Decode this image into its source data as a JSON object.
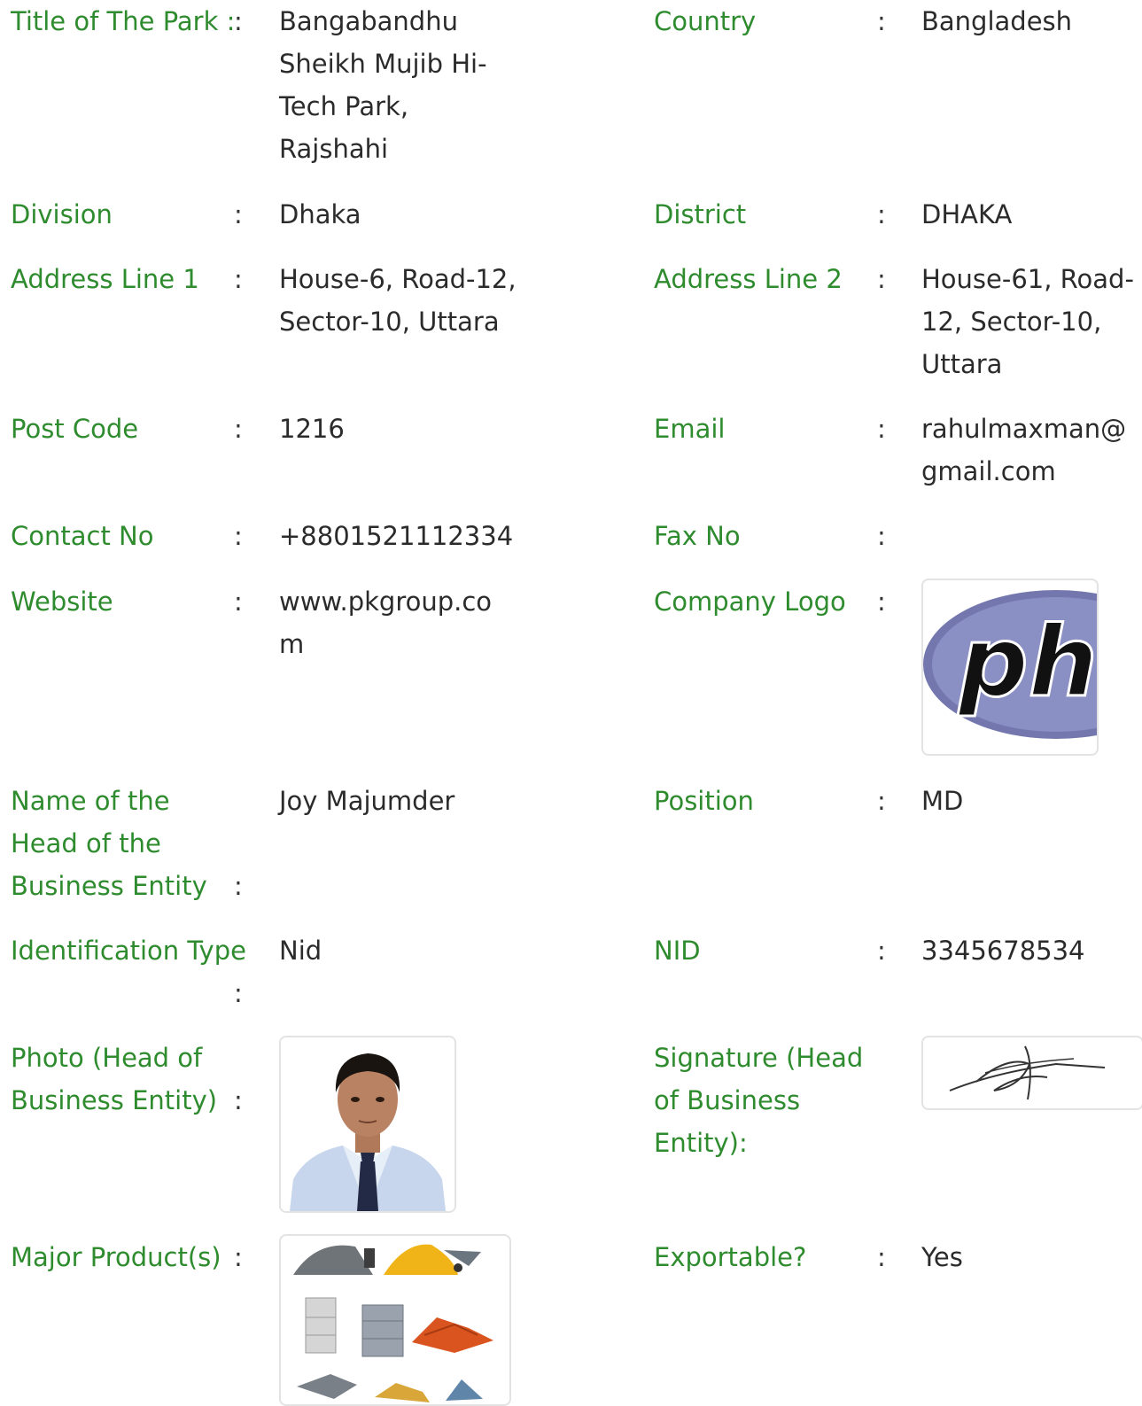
{
  "labels": {
    "title_of_park": "Title of The Park :",
    "country": "Country",
    "division": "Division",
    "district": "District",
    "address1": "Address Line 1",
    "address2": "Address Line 2",
    "post_code": "Post Code",
    "email": "Email",
    "contact_no": "Contact No",
    "fax_no": "Fax No",
    "website": "Website",
    "company_logo": "Company Logo",
    "head_name": "Name of the Head of the Business Entity",
    "position": "Position",
    "id_type": "Identification Type",
    "nid": "NID",
    "photo_head": "Photo (Head of Business Entity)",
    "signature_head": "Signature (Head of Business Entity):",
    "major_products": "Major Product(s)",
    "exportable": "Exportable?"
  },
  "colon": ":",
  "values": {
    "title_of_park": "Bangabandhu Sheikh Mujib Hi-Tech Park, Rajshahi",
    "country": "Bangladesh",
    "division": "Dhaka",
    "district": "DHAKA",
    "address1": "House-6, Road-12, Sector-10, Uttara",
    "address2": "House-61, Road-12, Sector-10, Uttara",
    "post_code": "1216",
    "email": "rahulmaxman@gmail.com",
    "contact_no": "+8801521112334",
    "fax_no": "",
    "website": "www.pkgroup.com",
    "head_name": "Joy Majumder",
    "position": "MD",
    "id_type": "Nid",
    "nid": "3345678534",
    "exportable": "Yes"
  },
  "images": {
    "company_logo": "php-logo",
    "photo_head": "person-photo",
    "signature_head": "signature",
    "major_products": "construction-materials"
  },
  "colors": {
    "label": "#2e8b2e",
    "value": "#2b2b2b",
    "php_purple": "#7377ad"
  }
}
